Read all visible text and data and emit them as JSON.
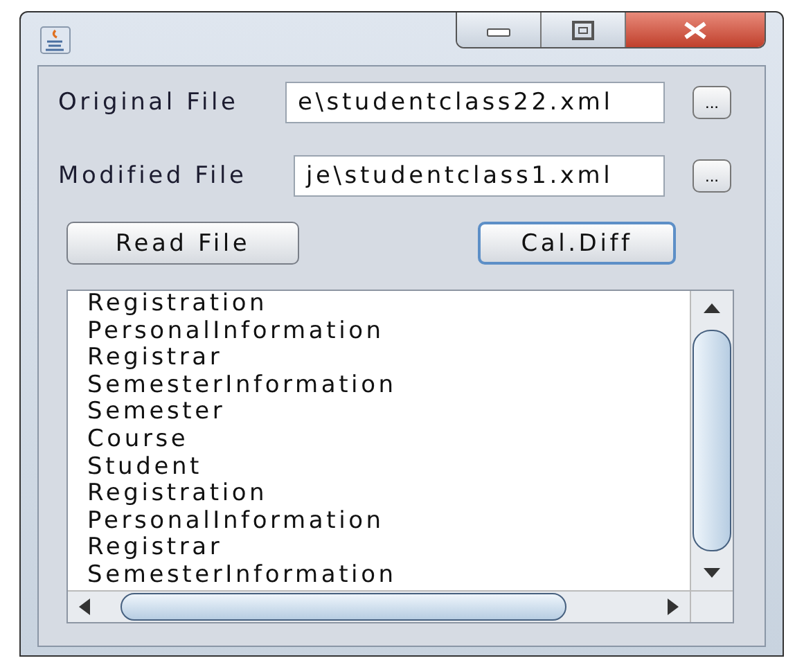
{
  "fields": [
    {
      "label": "Original File",
      "value": "e\\studentclass22.xml",
      "browse": "..."
    },
    {
      "label": "Modified File",
      "value": "je\\studentclass1.xml",
      "browse": "..."
    }
  ],
  "buttons": [
    {
      "label": "Read File",
      "focused": false
    },
    {
      "label": "Cal.Diff",
      "focused": true
    }
  ],
  "list": [
    "Registration",
    "PersonalInformation",
    "Registrar",
    "SemesterInformation",
    "Semester",
    "Course",
    "Student",
    "Registration",
    "PersonalInformation",
    "Registrar",
    "SemesterInformation"
  ]
}
